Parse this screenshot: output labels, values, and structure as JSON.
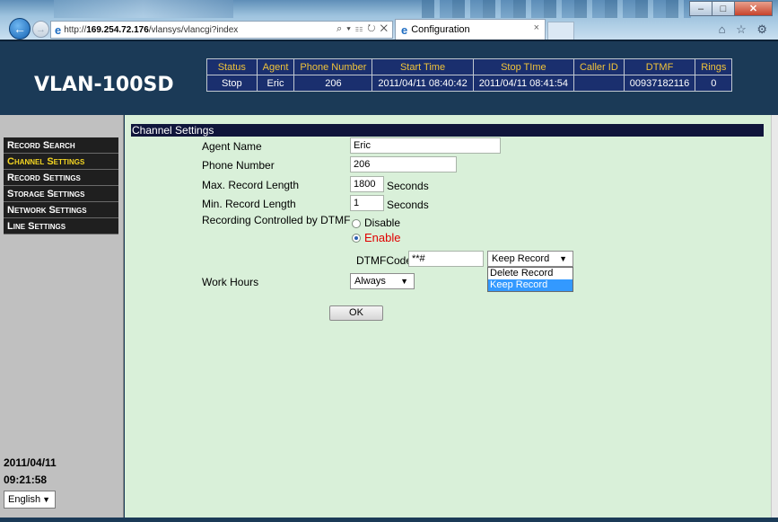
{
  "browser": {
    "url_prefix": "http://",
    "url_host": "169.254.72.176",
    "url_path": "/vlansys/vlancgi?index",
    "address_tools": "⌕ ▾ ☷ ↻ ✕",
    "tab_title": "Configuration",
    "tab_close": "×",
    "back_icon": "←",
    "forward_icon": "→",
    "right_icons": "⌂ ☆ ⚙",
    "window_minimize": "–",
    "window_maximize": "□",
    "window_close": "✕"
  },
  "header": {
    "logo": "VLAN-100SD",
    "status_columns": [
      "Status",
      "Agent",
      "Phone Number",
      "Start Time",
      "Stop TIme",
      "Caller ID",
      "DTMF",
      "Rings"
    ],
    "status_values": [
      "Stop",
      "Eric",
      "206",
      "2011/04/11 08:40:42",
      "2011/04/11 08:41:54",
      "",
      "00937182116",
      "0"
    ]
  },
  "sidebar": {
    "items": [
      {
        "label": "Record Search",
        "active": false
      },
      {
        "label": "Channel Settings",
        "active": true
      },
      {
        "label": "Record Settings",
        "active": false
      },
      {
        "label": "Storage Settings",
        "active": false
      },
      {
        "label": "Network Settings",
        "active": false
      },
      {
        "label": "Line Settings",
        "active": false
      }
    ],
    "date": "2011/04/11",
    "time": "09:21:58",
    "language": "English"
  },
  "form": {
    "section_title": "Channel Settings",
    "agent_name_label": "Agent Name",
    "agent_name_value": "Eric",
    "phone_number_label": "Phone Number",
    "phone_number_value": "206",
    "max_record_label": "Max. Record Length",
    "max_record_value": "1800",
    "max_record_unit": "Seconds",
    "min_record_label": "Min. Record Length",
    "min_record_value": "1",
    "min_record_unit": "Seconds",
    "dtmf_control_label": "Recording Controlled by DTMF",
    "disable_label": "Disable",
    "enable_label": "Enable",
    "dtmf_code_label": "DTMFCode",
    "dtmf_code_value": "**#",
    "dtmf_action_selected": "Keep Record",
    "dtmf_action_options": [
      "Delete Record",
      "Keep Record"
    ],
    "work_hours_label": "Work Hours",
    "work_hours_value": "Always",
    "ok_label": "OK",
    "enable_color": "#e00000"
  }
}
